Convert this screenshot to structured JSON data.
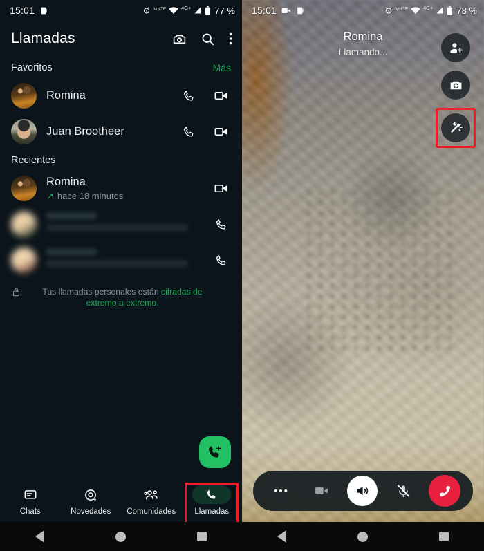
{
  "left_phone": {
    "status_bar": {
      "time": "15:01",
      "icons": [
        "screenshot-icon",
        "alarm-icon",
        "volte-icon",
        "wifi-icon",
        "4g-plus-icon",
        "signal-icon",
        "battery-icon"
      ],
      "network_label": "4G+",
      "volte_label": "VoLTE",
      "battery_percent": "77 %"
    },
    "app_bar": {
      "title": "Llamadas",
      "actions": [
        "camera-icon",
        "search-icon",
        "overflow-menu-icon"
      ]
    },
    "favorites": {
      "header": "Favoritos",
      "more_label": "Más",
      "items": [
        {
          "name": "Romina",
          "avatar": "av-romina",
          "actions": [
            "voice-call-icon",
            "video-call-icon"
          ]
        },
        {
          "name": "Juan Brootheer",
          "avatar": "av-juan",
          "actions": [
            "voice-call-icon",
            "video-call-icon"
          ]
        }
      ]
    },
    "recents": {
      "header": "Recientes",
      "items": [
        {
          "name": "Romina",
          "meta": "hace 18 minutos",
          "direction": "outgoing",
          "action": "video-call-icon",
          "redacted": false
        },
        {
          "name": "",
          "meta": "",
          "direction": "",
          "action": "voice-call-icon",
          "redacted": true
        },
        {
          "name": "",
          "meta": "",
          "direction": "",
          "action": "voice-call-icon",
          "redacted": true
        }
      ]
    },
    "encryption_note": {
      "prefix": "Tus llamadas personales están ",
      "highlight": "cifradas de extremo a extremo.",
      "icon": "lock-icon"
    },
    "fab": {
      "icon": "new-call-icon"
    },
    "bottom_nav": {
      "items": [
        {
          "label": "Chats",
          "icon": "chats-icon",
          "active": false
        },
        {
          "label": "Novedades",
          "icon": "status-updates-icon",
          "active": false
        },
        {
          "label": "Comunidades",
          "icon": "communities-icon",
          "active": false
        },
        {
          "label": "Llamadas",
          "icon": "calls-icon",
          "active": true
        }
      ],
      "highlighted_item": "Llamadas"
    },
    "system_nav": [
      "back-icon",
      "home-icon",
      "recents-icon"
    ]
  },
  "right_phone": {
    "status_bar": {
      "time": "15:01",
      "icons": [
        "video-recording-icon",
        "screenshot-icon",
        "alarm-icon",
        "volte-icon",
        "wifi-icon",
        "4g-plus-icon",
        "signal-icon",
        "battery-icon"
      ],
      "network_label": "4G+",
      "volte_label": "VoLTE",
      "battery_percent": "78 %"
    },
    "call": {
      "contact_name": "Romina",
      "status_text": "Llamando..."
    },
    "side_buttons": [
      {
        "icon": "add-participant-icon",
        "highlighted": false
      },
      {
        "icon": "switch-camera-icon",
        "highlighted": false
      },
      {
        "icon": "effects-wand-icon",
        "highlighted": true
      }
    ],
    "call_controls": [
      {
        "icon": "more-options-icon",
        "state": "default"
      },
      {
        "icon": "video-off-icon",
        "state": "disabled"
      },
      {
        "icon": "speaker-on-icon",
        "state": "active"
      },
      {
        "icon": "mic-muted-icon",
        "state": "muted"
      },
      {
        "icon": "end-call-icon",
        "state": "end"
      }
    ],
    "system_nav": [
      "back-icon",
      "home-icon",
      "recents-icon"
    ]
  },
  "colors": {
    "background": "#0b141b",
    "accent_green": "#1fa855",
    "fab_green": "#21c063",
    "active_pill": "#103629",
    "highlight_red": "#ee1d25",
    "end_call_red": "#e9203e",
    "text_primary": "#e9edef",
    "text_secondary": "#8696a0"
  }
}
